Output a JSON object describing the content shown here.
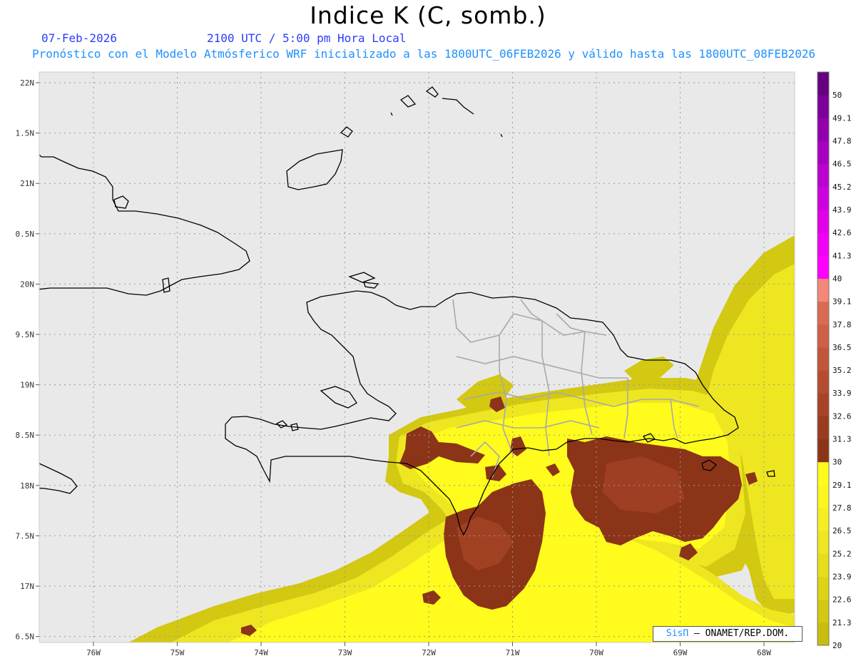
{
  "title": "Indice K (C, somb.)",
  "date": "07-Feb-2026",
  "time": "2100 UTC / 5:00 pm Hora Local",
  "description": "Pronóstico con el Modelo Atmósferico WRF inicializado a las 1800UTC_06FEB2026 y válido hasta las  1800UTC_08FEB2026",
  "credit": {
    "brand": "SisΠ",
    "rest": " – ONAMET/REP.DOM."
  },
  "lat_ticks": [
    {
      "label": "22N",
      "lat": 22.0
    },
    {
      "label": "1.5N",
      "lat": 21.5
    },
    {
      "label": "21N",
      "lat": 21.0
    },
    {
      "label": "0.5N",
      "lat": 20.5
    },
    {
      "label": "20N",
      "lat": 20.0
    },
    {
      "label": "9.5N",
      "lat": 19.5
    },
    {
      "label": "19N",
      "lat": 19.0
    },
    {
      "label": "8.5N",
      "lat": 18.5
    },
    {
      "label": "18N",
      "lat": 18.0
    },
    {
      "label": "7.5N",
      "lat": 17.5
    },
    {
      "label": "17N",
      "lat": 17.0
    },
    {
      "label": "6.5N",
      "lat": 16.5
    }
  ],
  "lon_ticks": [
    {
      "label": "76W",
      "lon": -76
    },
    {
      "label": "75W",
      "lon": -75
    },
    {
      "label": "74W",
      "lon": -74
    },
    {
      "label": "73W",
      "lon": -73
    },
    {
      "label": "72W",
      "lon": -72
    },
    {
      "label": "71W",
      "lon": -71
    },
    {
      "label": "70W",
      "lon": -70
    },
    {
      "label": "69W",
      "lon": -69
    },
    {
      "label": "68W",
      "lon": -68
    }
  ],
  "colorbar": [
    {
      "label": "20",
      "color": "#c8bd0d"
    },
    {
      "label": "21.3",
      "color": "#d3c812"
    },
    {
      "label": "22.6",
      "color": "#ddd317"
    },
    {
      "label": "23.9",
      "color": "#e6dd1c"
    },
    {
      "label": "25.2",
      "color": "#eee621"
    },
    {
      "label": "26.5",
      "color": "#f5ee22"
    },
    {
      "label": "27.8",
      "color": "#fbf520"
    },
    {
      "label": "29.1",
      "color": "#fffb1c"
    },
    {
      "label": "30",
      "color": "#8b3418"
    },
    {
      "label": "31.3",
      "color": "#9a3b1f"
    },
    {
      "label": "32.6",
      "color": "#a84327"
    },
    {
      "label": "33.9",
      "color": "#b54c30"
    },
    {
      "label": "35.2",
      "color": "#c2563b"
    },
    {
      "label": "36.5",
      "color": "#cd6047"
    },
    {
      "label": "37.8",
      "color": "#d96b53"
    },
    {
      "label": "39.1",
      "color": "#f3877a"
    },
    {
      "label": "40",
      "color": "#ff00ff"
    },
    {
      "label": "41.3",
      "color": "#f000f5"
    },
    {
      "label": "42.6",
      "color": "#e000ea"
    },
    {
      "label": "43.9",
      "color": "#cf00de"
    },
    {
      "label": "45.2",
      "color": "#bb00d0"
    },
    {
      "label": "46.5",
      "color": "#a700c0"
    },
    {
      "label": "47.8",
      "color": "#9200ad"
    },
    {
      "label": "49.1",
      "color": "#7c0098"
    },
    {
      "label": "50",
      "color": "#660080"
    }
  ],
  "colors": {
    "background": "#e9e9e9",
    "coastline": "#000000",
    "provinces": "#a9a9a9",
    "gridline": "#9a9a9a",
    "yellow_outer": "#d3c812",
    "yellow_mid": "#eee621",
    "yellow_inner": "#fffb1c",
    "brown": "#8b3418",
    "brown_light": "#b54c30"
  }
}
